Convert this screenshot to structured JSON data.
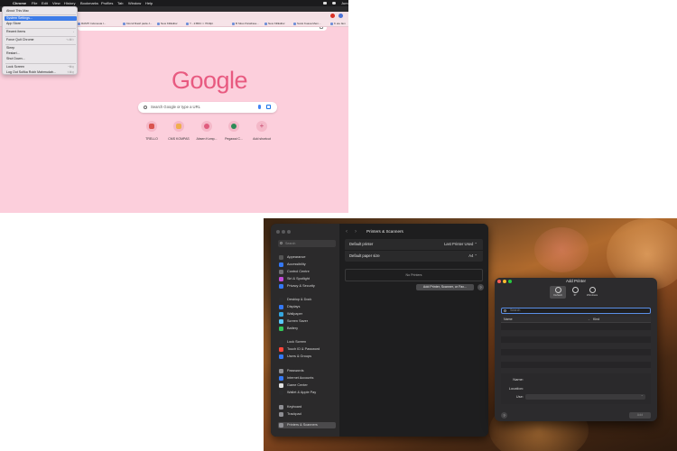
{
  "menubar": {
    "app": "Chrome",
    "items": [
      "File",
      "Edit",
      "View",
      "History",
      "Bookmarks",
      "Profiles",
      "Tab",
      "Window",
      "Help"
    ],
    "clock": "Jum"
  },
  "bookmarks": [
    "RAMTI Indonesia I...",
    "Klozuf Rasif pada J...",
    "New KillEditor",
    "Y - 2:BDC × 7640pt",
    "B Situs Parafrase...",
    "New KillEditor",
    "Surat Kuasa Mem...",
    "K ete fam"
  ],
  "apple_menu": {
    "items": [
      {
        "label": "About This Mac",
        "shortcut": ""
      },
      {
        "label": "System Settings...",
        "shortcut": ""
      },
      {
        "label": "App Store",
        "shortcut": ""
      },
      {
        "label": "Recent Items",
        "shortcut": "›"
      },
      {
        "label": "Force Quit Chrome",
        "shortcut": "⌥⌘⎋"
      },
      {
        "label": "Sleep",
        "shortcut": ""
      },
      {
        "label": "Restart...",
        "shortcut": ""
      },
      {
        "label": "Shut Down...",
        "shortcut": ""
      },
      {
        "label": "Lock Screen",
        "shortcut": "^⌘Q"
      },
      {
        "label": "Log Out Sufika Rokh Mahmudah...",
        "shortcut": "⇧⌘Q"
      }
    ]
  },
  "google": {
    "logo": "Google",
    "search_placeholder": "Search Google or type a URL",
    "shortcuts": [
      {
        "label": "TRELLO",
        "color": "#d9534f"
      },
      {
        "label": "CMS KOMPAS",
        "color": "#f0ad4e"
      },
      {
        "label": "Absen Komp...",
        "color": "#e05c7e"
      },
      {
        "label": "Pegawai C...",
        "color": "#2e8b57"
      },
      {
        "label": "Add shortcut",
        "color": "#e88aa3"
      }
    ]
  },
  "settings": {
    "search_placeholder": "Search",
    "title": "Printers & Scanners",
    "sidebar": [
      {
        "label": "Appearance",
        "color": "#555555"
      },
      {
        "label": "Accessibility",
        "color": "#3478f6"
      },
      {
        "label": "Control Centre",
        "color": "#6e6e72"
      },
      {
        "label": "Siri & Spotlight",
        "color": "#c04bd8"
      },
      {
        "label": "Privacy & Security",
        "color": "#3478f6"
      },
      {
        "label": "Desktop & Dock",
        "color": "#2c2c2e"
      },
      {
        "label": "Displays",
        "color": "#3478f6"
      },
      {
        "label": "Wallpaper",
        "color": "#35a7e0"
      },
      {
        "label": "Screen Saver",
        "color": "#5ac8fa"
      },
      {
        "label": "Battery",
        "color": "#34c759"
      },
      {
        "label": "Lock Screen",
        "color": "#2c2c2e"
      },
      {
        "label": "Touch ID & Password",
        "color": "#ff453a"
      },
      {
        "label": "Users & Groups",
        "color": "#3478f6"
      },
      {
        "label": "Passwords",
        "color": "#8e8e93"
      },
      {
        "label": "Internet Accounts",
        "color": "#3478f6"
      },
      {
        "label": "Game Center",
        "color": "#e0e0e0"
      },
      {
        "label": "Wallet & Apple Pay",
        "color": "#2c2c2e"
      },
      {
        "label": "Keyboard",
        "color": "#8e8e93"
      },
      {
        "label": "Trackpad",
        "color": "#8e8e93"
      },
      {
        "label": "Printers & Scanners",
        "color": "#8e8e93"
      }
    ],
    "rows": [
      {
        "label": "Default printer",
        "value": "Last Printer Used ⌃"
      },
      {
        "label": "Default paper size",
        "value": "A4 ⌃"
      }
    ],
    "no_printers": "No Printers",
    "add_button": "Add Printer, Scanner, or Fax...",
    "help": "?"
  },
  "add_printer": {
    "title": "Add Printer",
    "tabs": [
      "Default",
      "IP",
      "Windows"
    ],
    "search_placeholder": "Search",
    "columns": [
      "Name",
      "Kind"
    ],
    "fields": [
      "Name:",
      "Location:",
      "Use:"
    ],
    "help": "?",
    "add_button": "Add"
  }
}
